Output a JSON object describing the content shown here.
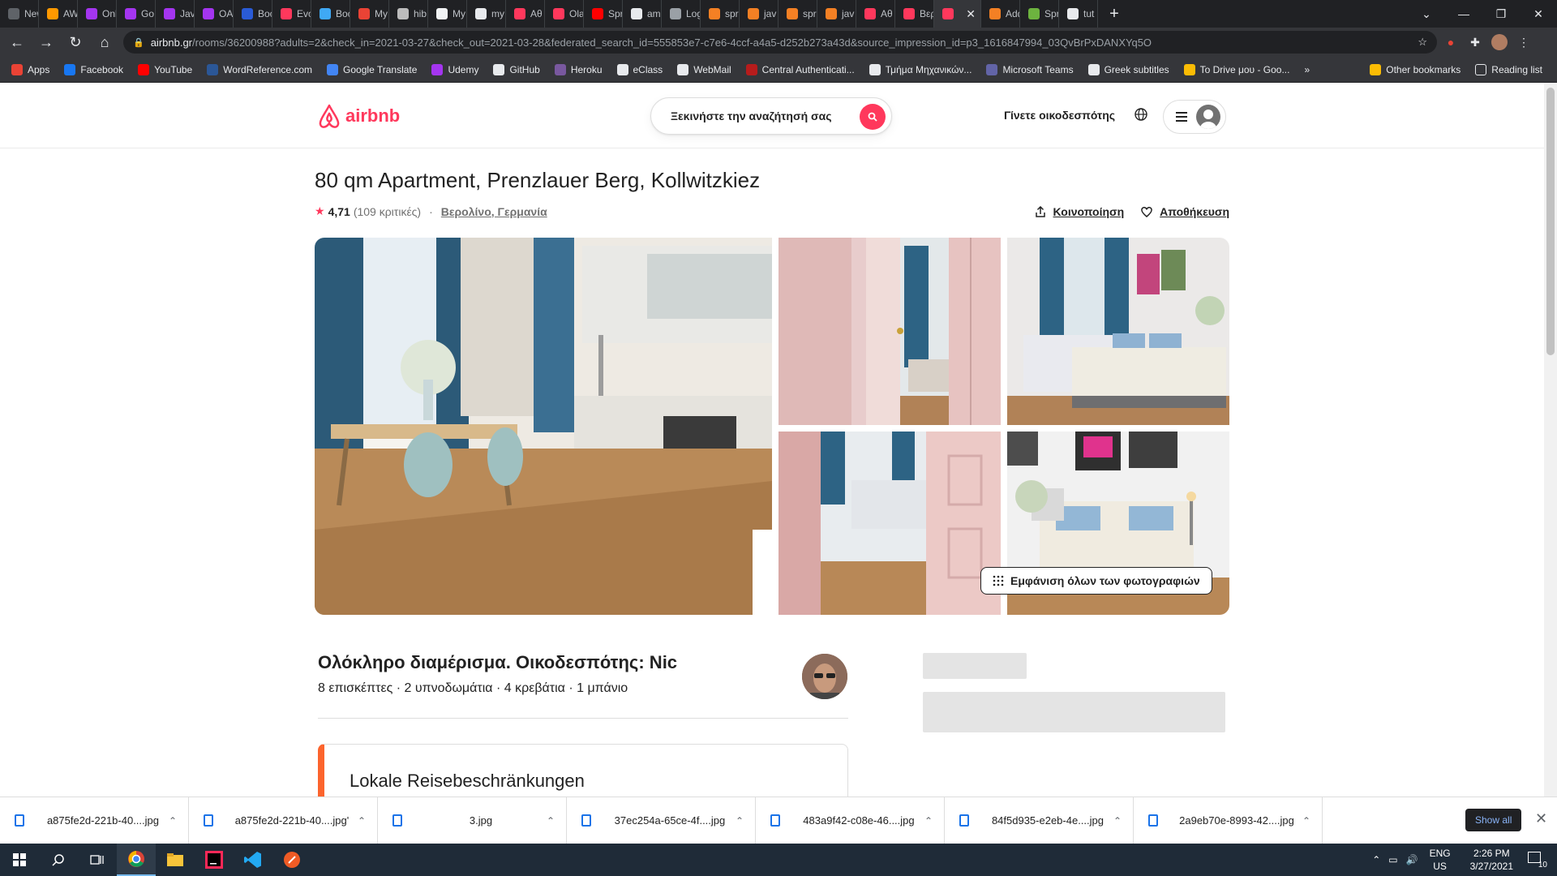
{
  "browser": {
    "tabs": [
      {
        "label": "New Tal",
        "color": "#5f6368"
      },
      {
        "label": "AW",
        "color": "#ff9900"
      },
      {
        "label": "Onl",
        "color": "#a435f0"
      },
      {
        "label": "Go",
        "color": "#a435f0"
      },
      {
        "label": "Jav",
        "color": "#a435f0"
      },
      {
        "label": "OA",
        "color": "#a435f0"
      },
      {
        "label": "Boc",
        "color": "#2a5bd7"
      },
      {
        "label": "Evo",
        "color": "#ff385c"
      },
      {
        "label": "Boc",
        "color": "#3fa9f5"
      },
      {
        "label": "My",
        "color": "#ea4335"
      },
      {
        "label": "hib",
        "color": "#bcbcbc"
      },
      {
        "label": "My",
        "color": "#f1f3f4"
      },
      {
        "label": "my",
        "color": "#e8eaed"
      },
      {
        "label": "Αθ",
        "color": "#ff385c"
      },
      {
        "label": "Ola",
        "color": "#ff385c"
      },
      {
        "label": "Spr",
        "color": "#ff0000"
      },
      {
        "label": "am",
        "color": "#e8eaed"
      },
      {
        "label": "Log",
        "color": "#9aa0a6"
      },
      {
        "label": "spr",
        "color": "#f48024"
      },
      {
        "label": "jav",
        "color": "#f48024"
      },
      {
        "label": "spr",
        "color": "#f48024"
      },
      {
        "label": "jav",
        "color": "#f48024"
      },
      {
        "label": "Αθ",
        "color": "#ff385c"
      },
      {
        "label": "Βερ",
        "color": "#ff385c"
      }
    ],
    "active_tab_close": "✕",
    "tabs_after": [
      {
        "label": "Add",
        "color": "#f48024"
      },
      {
        "label": "Spr",
        "color": "#6db33f"
      },
      {
        "label": "tut",
        "color": "#e8eaed"
      }
    ],
    "url_host": "airbnb.gr",
    "url_path": "/rooms/36200988?adults=2&check_in=2021-03-27&check_out=2021-03-28&federated_search_id=555853e7-c7e6-4ccf-a4a5-d252b273a43d&source_impression_id=p3_1616847994_03QvBrPxDANXYq5O",
    "bookmarks": [
      {
        "label": "Apps",
        "color": "#ea4335"
      },
      {
        "label": "Facebook",
        "color": "#1877f2"
      },
      {
        "label": "YouTube",
        "color": "#ff0000"
      },
      {
        "label": "WordReference.com",
        "color": "#2b5797"
      },
      {
        "label": "Google Translate",
        "color": "#4285f4"
      },
      {
        "label": "Udemy",
        "color": "#a435f0"
      },
      {
        "label": "GitHub",
        "color": "#e8eaed"
      },
      {
        "label": "Heroku",
        "color": "#79589f"
      },
      {
        "label": "eClass",
        "color": "#e8eaed"
      },
      {
        "label": "WebMail",
        "color": "#e8eaed"
      },
      {
        "label": "Central Authenticati...",
        "color": "#b71c1c"
      },
      {
        "label": "Τμήμα Μηχανικών...",
        "color": "#e8eaed"
      },
      {
        "label": "Microsoft Teams",
        "color": "#6264a7"
      },
      {
        "label": "Greek subtitles",
        "color": "#e8eaed"
      },
      {
        "label": "To Drive μου - Goo...",
        "color": "#fbbc04"
      }
    ],
    "bookmarks_more": "»",
    "other_bookmarks": "Other bookmarks",
    "reading_list": "Reading list"
  },
  "airbnb": {
    "brand_color": "#ff385c",
    "logo_text": "airbnb",
    "search_placeholder": "Ξεκινήστε την αναζήτησή σας",
    "host_link": "Γίνετε οικοδεσπότης",
    "listing_title": "80 qm Apartment, Prenzlauer Berg, Kollwitzkiez",
    "rating": "4,71",
    "reviews": "(109 κριτικές)",
    "separator": "·",
    "location": "Βερολίνο, Γερμανία",
    "share_label": "Κοινοποίηση",
    "save_label": "Αποθήκευση",
    "show_all_photos": "Εμφάνιση όλων των φωτογραφιών",
    "listing_type": "Ολόκληρο διαμέρισμα. Οικοδεσπότης: Nic",
    "listing_details": "8 επισκέπτες · 2 υπνοδωμάτια · 4 κρεβάτια · 1 μπάνιο",
    "travel_restrictions": "Lokale Reisebeschränkungen"
  },
  "downloads": {
    "items": [
      "a875fe2d-221b-40....jpg",
      "a875fe2d-221b-40....jpg'",
      "3.jpg",
      "37ec254a-65ce-4f....jpg",
      "483a9f42-c08e-46....jpg",
      "84f5d935-e2eb-4e....jpg",
      "2a9eb70e-8993-42....jpg"
    ],
    "show_all": "Show all"
  },
  "taskbar": {
    "lang_line1": "ENG",
    "lang_line2": "US",
    "time": "2:26 PM",
    "date": "3/27/2021",
    "notifications": "10"
  }
}
